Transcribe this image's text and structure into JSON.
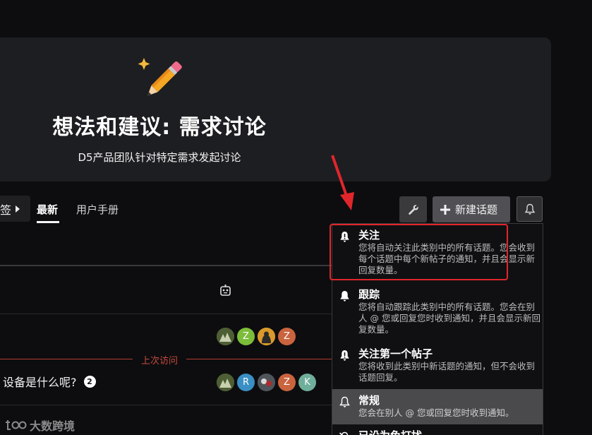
{
  "banner": {
    "title": "想法和建议: 需求讨论",
    "subtitle": "D5产品团队针对特定需求发起讨论",
    "emoji": "pencil-sparkle-icon"
  },
  "nav": {
    "tag_label": "签",
    "latest_label": "最新",
    "manual_label": "用户手册"
  },
  "toolbar": {
    "new_topic_label": "新建话题"
  },
  "table": {
    "last_visit_label": "上次访问",
    "topic_title": "设备是什么呢?",
    "topic_count": "2",
    "row1_avatars": [
      {
        "type": "photo",
        "color": "#6b7d4a"
      },
      {
        "letter": "Z",
        "color": "#7cbd3a"
      },
      {
        "type": "photo",
        "color": "#d99a2b"
      },
      {
        "letter": "Z",
        "color": "#c9643e"
      }
    ],
    "row2_avatars": [
      {
        "type": "photo",
        "color": "#6b7d4a"
      },
      {
        "letter": "R",
        "color": "#3a8fc4"
      },
      {
        "type": "photo",
        "color": "#555a60"
      },
      {
        "letter": "Z",
        "color": "#c9643e"
      },
      {
        "letter": "K",
        "color": "#6fae9a"
      }
    ]
  },
  "watermark": {
    "logo": "tk-logo-icon",
    "text": "大数跨境"
  },
  "dropdown": {
    "items": [
      {
        "title": "关注",
        "desc": "您将自动关注此类别中的所有话题。您会收到每个话题中每个新帖子的通知，并且会显示新回复数量。",
        "icon": "bell-exclamation-icon"
      },
      {
        "title": "跟踪",
        "desc": "您将自动跟踪此类别中的所有话题。您会在别人 @ 您或回复您时收到通知，并且会显示新回复数量。",
        "icon": "bell-icon"
      },
      {
        "title": "关注第一个帖子",
        "desc": "您将收到此类别中新话题的通知，但不会收到话题回复。",
        "icon": "bell-exclamation-icon"
      },
      {
        "title": "常规",
        "desc": "您会在别人 @ 您或回复您时收到通知。",
        "icon": "bell-outline-icon"
      },
      {
        "title": "已设为免打扰",
        "desc": "",
        "icon": "bell-slash-icon"
      }
    ]
  },
  "colors": {
    "highlight_red": "#e0262b",
    "last_visit_red": "#c84a3e"
  }
}
